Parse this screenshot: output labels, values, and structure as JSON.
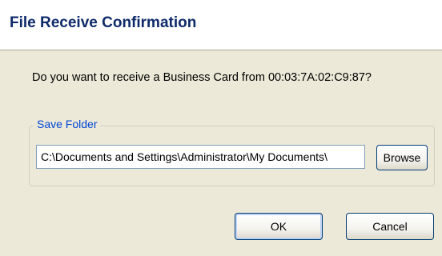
{
  "window": {
    "title": "File Receive Confirmation"
  },
  "message": {
    "question": "Do you want to receive a Business Card from 00:03:7A:02:C9:87?"
  },
  "save_folder": {
    "group_label": "Save Folder",
    "path_value": "C:\\Documents and Settings\\Administrator\\My Documents\\",
    "browse_label": "Browse"
  },
  "buttons": {
    "ok_label": "OK",
    "cancel_label": "Cancel"
  },
  "colors": {
    "title_text": "#0e2a6a",
    "dialog_face": "#ece9d8",
    "group_label": "#0046d5",
    "button_border": "#003c74"
  }
}
